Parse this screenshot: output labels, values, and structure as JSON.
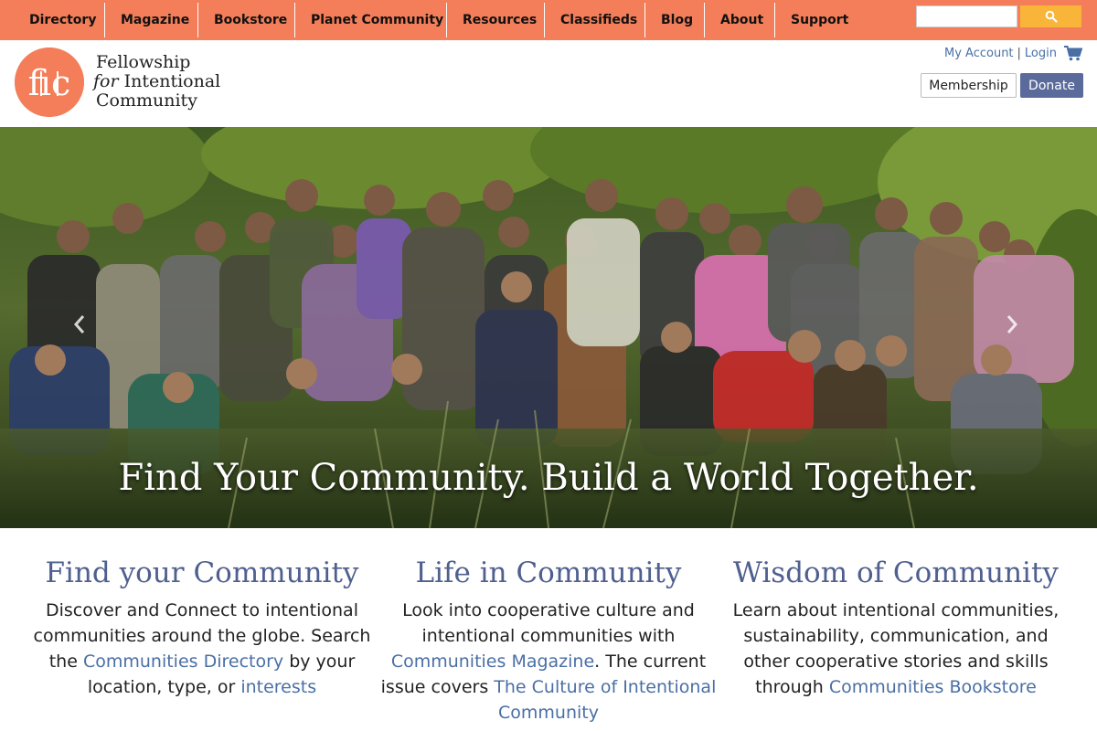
{
  "nav": {
    "items": [
      "Directory",
      "Magazine",
      "Bookstore",
      "Planet Community",
      "Resources",
      "Classifieds",
      "Blog",
      "About",
      "Support"
    ],
    "search_placeholder": ""
  },
  "header": {
    "logo_mark": "fic",
    "logo_line1": "Fellowship",
    "logo_line2_for": "for",
    "logo_line2_rest": " Intentional",
    "logo_line3": "Community",
    "my_account": "My Account",
    "separator": "|",
    "login": "Login",
    "membership": "Membership",
    "donate": "Donate"
  },
  "hero": {
    "caption": "Find Your Community. Build a World Together.",
    "prev_icon": "chevron-left-icon",
    "next_icon": "chevron-right-icon"
  },
  "columns": [
    {
      "title": "Find your Community",
      "text_a": "Discover and Connect to intentional communities around the globe. Search the ",
      "link1": "Communities Directory",
      "text_b": " by your location, type, or ",
      "link2": "interests"
    },
    {
      "title": "Life in Community",
      "text_a": "Look into cooperative culture and intentional communities with ",
      "link1": "Communities Magazine",
      "text_b": ". The current issue covers ",
      "link2": "The Culture of Intentional Community"
    },
    {
      "title": "Wisdom of Community",
      "text_a": "Learn about intentional communities, sustainability, communication, and other cooperative stories and skills through ",
      "link1": "Communities Bookstore",
      "text_b": "",
      "link2": ""
    }
  ],
  "colors": {
    "nav_bg": "#f37e59",
    "search_btn": "#f8b53a",
    "donate_bg": "#5a6a9a",
    "heading": "#4f5f8f",
    "link": "#4a6fa5"
  }
}
